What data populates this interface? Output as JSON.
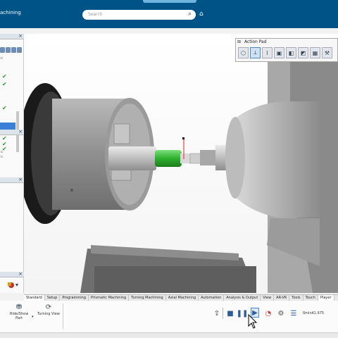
{
  "app": {
    "title": "achining"
  },
  "search": {
    "placeholder": "Search"
  },
  "left_panel": {
    "side_text": [
      "ic",
      "ti",
      "e",
      "ti"
    ]
  },
  "action_pad": {
    "title": "Action Pad"
  },
  "ribbon_tabs": [
    {
      "label": "Standard",
      "active": true
    },
    {
      "label": "Setup",
      "active": false
    },
    {
      "label": "Programming",
      "active": false
    },
    {
      "label": "Prismatic Machining",
      "active": false
    },
    {
      "label": "Turning Machining",
      "active": false
    },
    {
      "label": "Axial Machining",
      "active": false
    },
    {
      "label": "Automation",
      "active": false
    },
    {
      "label": "Analysis & Output",
      "active": false
    },
    {
      "label": "View",
      "active": false
    },
    {
      "label": "AR-VR",
      "active": false
    },
    {
      "label": "Tools",
      "active": false
    },
    {
      "label": "Touch",
      "active": false
    },
    {
      "label": "Player",
      "active": false
    }
  ],
  "ribbon": {
    "hide_show": "Hide/Show Part",
    "turning_view": "Turning View"
  },
  "player": {
    "readout": "0min41.975"
  },
  "colors": {
    "topbar": "#005386",
    "selection": "#3b7fd9",
    "tool_green": "#2fb02f",
    "active_tab": "#ffffff"
  },
  "icons": [
    "search-icon",
    "tag-icon",
    "close-icon",
    "check-icon",
    "hide-show-icon",
    "turning-view-icon",
    "export-icon",
    "stop-icon",
    "pause-icon",
    "play-icon",
    "speed-icon",
    "settings-icon",
    "list-icon"
  ]
}
